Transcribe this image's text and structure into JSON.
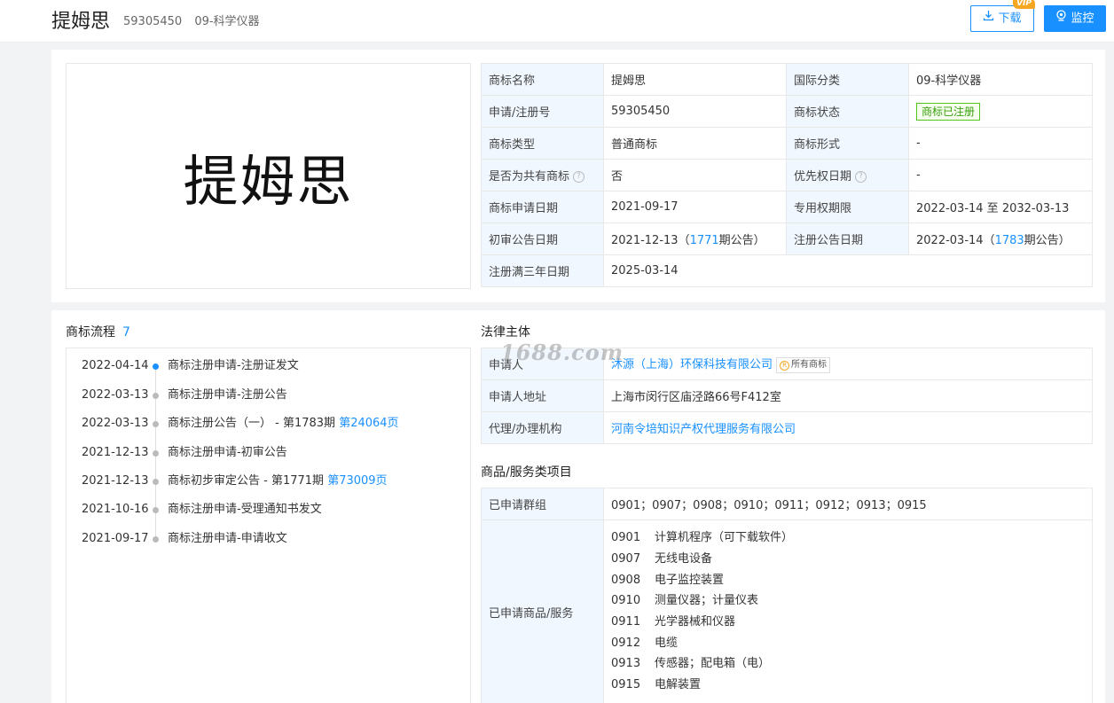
{
  "header": {
    "title": "提姆思",
    "reg_no": "59305450",
    "class_label": "09-科学仪器",
    "download_label": "下载",
    "vip_label": "VIP",
    "monitor_label": "监控"
  },
  "logo_text": "提姆思",
  "info_table": [
    {
      "l1": "商标名称",
      "v1": "提姆思",
      "l2": "国际分类",
      "v2": "09-科学仪器"
    },
    {
      "l1": "申请/注册号",
      "v1": "59305450",
      "l2": "商标状态",
      "v2": "商标已注册"
    },
    {
      "l1": "商标类型",
      "v1": "普通商标",
      "l2": "商标形式",
      "v2": "-"
    },
    {
      "l1": "是否为共有商标",
      "v1": "否",
      "l2": "优先权日期",
      "v2": "-"
    },
    {
      "l1": "商标申请日期",
      "v1": "2021-09-17",
      "l2": "专用权期限",
      "v2": "2022-03-14 至 2032-03-13"
    },
    {
      "l1": "初审公告日期",
      "v1_date": "2021-12-13（",
      "v1_link": "1771",
      "v1_suffix": "期公告）",
      "l2": "注册公告日期",
      "v2_date": "2022-03-14（",
      "v2_link": "1783",
      "v2_suffix": "期公告）"
    },
    {
      "l1": "注册满三年日期",
      "v1": "2025-03-14"
    }
  ],
  "flow": {
    "title": "商标流程",
    "count": "7",
    "items": [
      {
        "date": "2022-04-14",
        "text": "商标注册申请-注册证发文",
        "link": ""
      },
      {
        "date": "2022-03-13",
        "text": "商标注册申请-注册公告",
        "link": ""
      },
      {
        "date": "2022-03-13",
        "text": "商标注册公告（一） - 第1783期 ",
        "link": "第24064页"
      },
      {
        "date": "2021-12-13",
        "text": "商标注册申请-初审公告",
        "link": ""
      },
      {
        "date": "2021-12-13",
        "text": "商标初步审定公告 - 第1771期 ",
        "link": "第73009页"
      },
      {
        "date": "2021-10-16",
        "text": "商标注册申请-受理通知书发文",
        "link": ""
      },
      {
        "date": "2021-09-17",
        "text": "商标注册申请-申请收文",
        "link": ""
      }
    ]
  },
  "legal": {
    "title": "法律主体",
    "applicant_label": "申请人",
    "applicant_value": "沐源（上海）环保科技有限公司",
    "all_marks_label": "所有商标",
    "address_label": "申请人地址",
    "address_value": "上海市闵行区庙泾路66号F412室",
    "agent_label": "代理/办理机构",
    "agent_value": "河南令培知识产权代理服务有限公司"
  },
  "goods": {
    "title": "商品/服务类项目",
    "groups_label": "已申请群组",
    "groups_value": "0901；0907；0908；0910；0911；0912；0913；0915",
    "items_label": "已申请商品/服务",
    "items": [
      {
        "code": "0901",
        "name": "计算机程序（可下载软件）"
      },
      {
        "code": "0907",
        "name": "无线电设备"
      },
      {
        "code": "0908",
        "name": "电子监控装置"
      },
      {
        "code": "0910",
        "name": "测量仪器；计量仪表"
      },
      {
        "code": "0911",
        "name": "光学器械和仪器"
      },
      {
        "code": "0912",
        "name": "电缆"
      },
      {
        "code": "0913",
        "name": "传感器；配电箱（电）"
      },
      {
        "code": "0915",
        "name": "电解装置"
      }
    ]
  },
  "watermark": "1688.com",
  "colors": {
    "accent": "#1890ff",
    "label_bg": "#f0f7ff",
    "status_green": "#52c41a",
    "vip": "#f5a623"
  }
}
